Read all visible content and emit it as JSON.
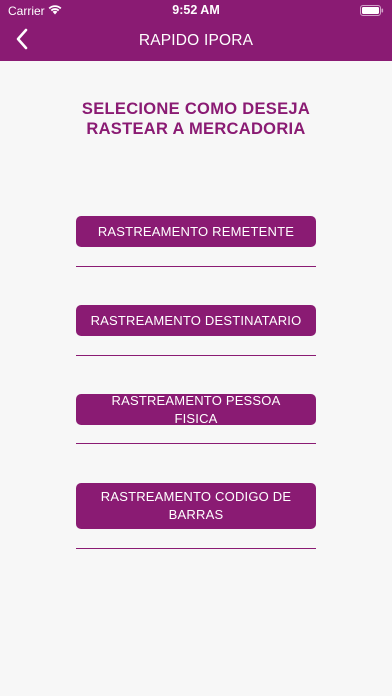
{
  "status_bar": {
    "carrier": "Carrier",
    "time": "9:52 AM",
    "wifi_icon": "wifi-icon",
    "battery_icon": "battery-icon"
  },
  "nav": {
    "title": "RAPIDO IPORA",
    "back_icon": "chevron-left-icon"
  },
  "main": {
    "headline": "SELECIONE COMO DESEJA RASTEAR A MERCADORIA",
    "options": [
      {
        "label": "RASTREAMENTO REMETENTE"
      },
      {
        "label": "RASTREAMENTO DESTINATARIO"
      },
      {
        "label": "RASTREAMENTO PESSOA FISICA"
      },
      {
        "label": "RASTREAMENTO CODIGO DE BARRAS"
      }
    ]
  },
  "colors": {
    "brand": "#8a1b73",
    "background": "#f7f7f7",
    "text_on_brand": "#ffffff"
  }
}
